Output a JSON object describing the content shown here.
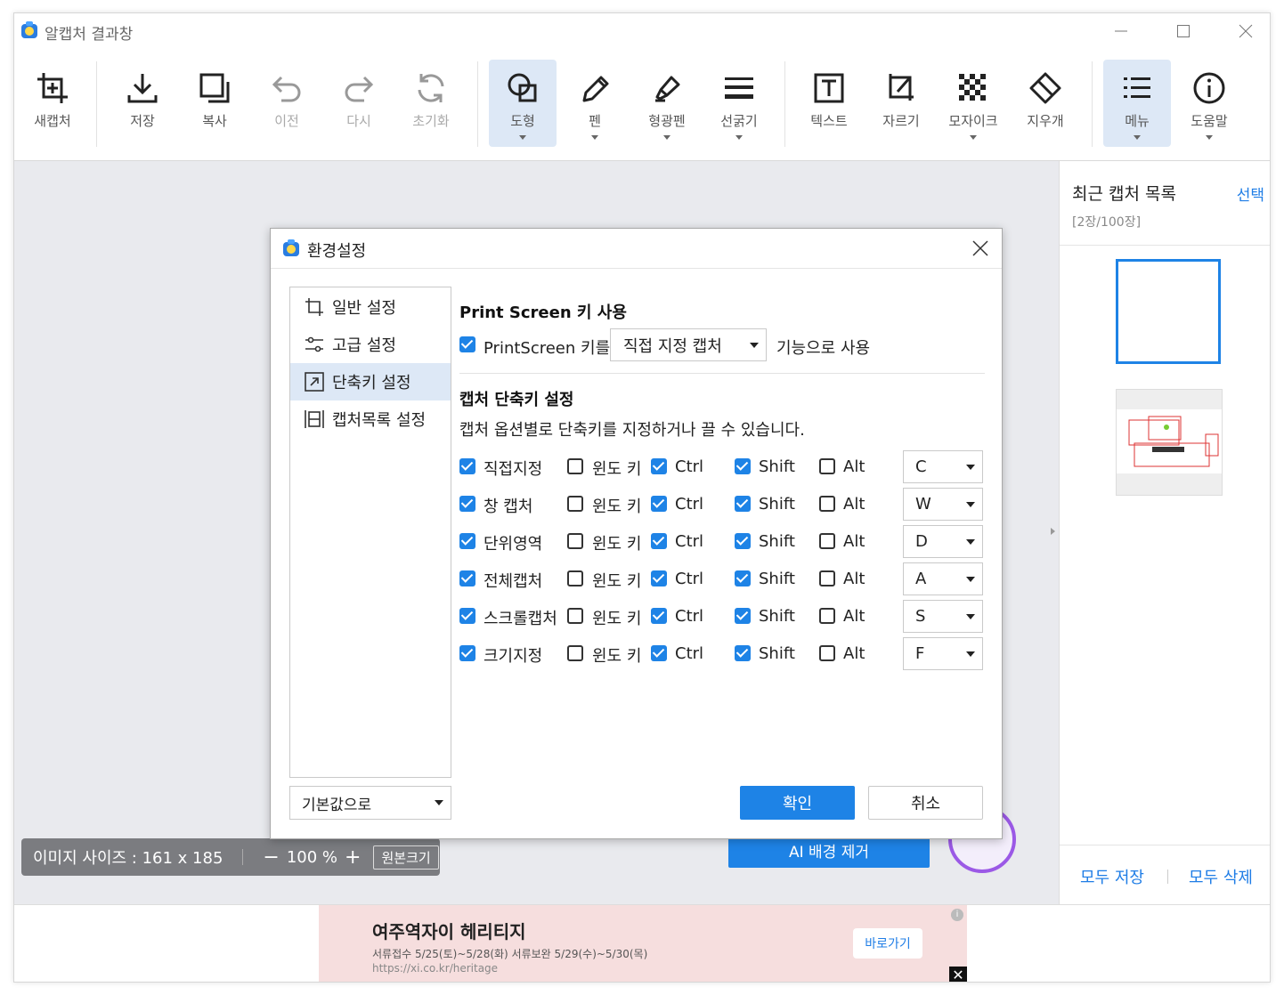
{
  "window": {
    "title": "알캡처 결과창"
  },
  "toolbar": {
    "new_capture": "새캡처",
    "save": "저장",
    "copy": "복사",
    "undo": "이전",
    "redo": "다시",
    "reset": "초기화",
    "shape": "도형",
    "pen": "펜",
    "highlighter": "형광펜",
    "line_width": "선굵기",
    "text": "텍스트",
    "crop": "자르기",
    "mosaic": "모자이크",
    "eraser": "지우개",
    "menu": "메뉴",
    "help": "도움말"
  },
  "right_panel": {
    "title": "최근 캡처 목록",
    "select": "선택",
    "count": "[2장/100장]",
    "save_all": "모두 저장",
    "delete_all": "모두 삭제"
  },
  "status": {
    "image_size": "이미지 사이즈 : 161 x 185",
    "zoom_out": "−",
    "zoom": "100 %",
    "zoom_in": "+",
    "original_size": "원본크기"
  },
  "ai_button": "AI 배경 제거",
  "ad": {
    "title": "여주역자이 헤리티지",
    "subtitle": "서류접수 5/25(토)~5/28(화) 서류보완 5/29(수)~5/30(목)",
    "url": "https://xi.co.kr/heritage",
    "go": "바로가기",
    "info": "i",
    "close": "✕"
  },
  "dialog": {
    "title": "환경설정",
    "nav": [
      {
        "label": "일반 설정",
        "icon": "crop-icon"
      },
      {
        "label": "고급 설정",
        "icon": "sliders-icon"
      },
      {
        "label": "단축키 설정",
        "icon": "shortcut-arrow-icon"
      },
      {
        "label": "캡처목록 설정",
        "icon": "capture-list-icon"
      }
    ],
    "selected_nav": 2,
    "default_button": "기본값으로",
    "printscreen": {
      "heading": "Print Screen 키 사용",
      "checkbox_label": "PrintScreen 키를",
      "checked": true,
      "combo_value": "직접 지정 캡처",
      "suffix": "기능으로 사용"
    },
    "shortcuts": {
      "heading": "캡처 단축키 설정",
      "description": "캡처 옵션별로 단축키를 지정하거나 끌 수 있습니다.",
      "win_label": "윈도 키",
      "ctrl_label": "Ctrl",
      "shift_label": "Shift",
      "alt_label": "Alt",
      "rows": [
        {
          "name": "직접지정",
          "enabled": true,
          "win": false,
          "ctrl": true,
          "shift": true,
          "alt": false,
          "key": "C"
        },
        {
          "name": "창 캡처",
          "enabled": true,
          "win": false,
          "ctrl": true,
          "shift": true,
          "alt": false,
          "key": "W"
        },
        {
          "name": "단위영역",
          "enabled": true,
          "win": false,
          "ctrl": true,
          "shift": true,
          "alt": false,
          "key": "D"
        },
        {
          "name": "전체캡처",
          "enabled": true,
          "win": false,
          "ctrl": true,
          "shift": true,
          "alt": false,
          "key": "A"
        },
        {
          "name": "스크롤캡처",
          "enabled": true,
          "win": false,
          "ctrl": true,
          "shift": true,
          "alt": false,
          "key": "S"
        },
        {
          "name": "크기지정",
          "enabled": true,
          "win": false,
          "ctrl": true,
          "shift": true,
          "alt": false,
          "key": "F"
        }
      ]
    },
    "ok": "확인",
    "cancel": "취소"
  }
}
